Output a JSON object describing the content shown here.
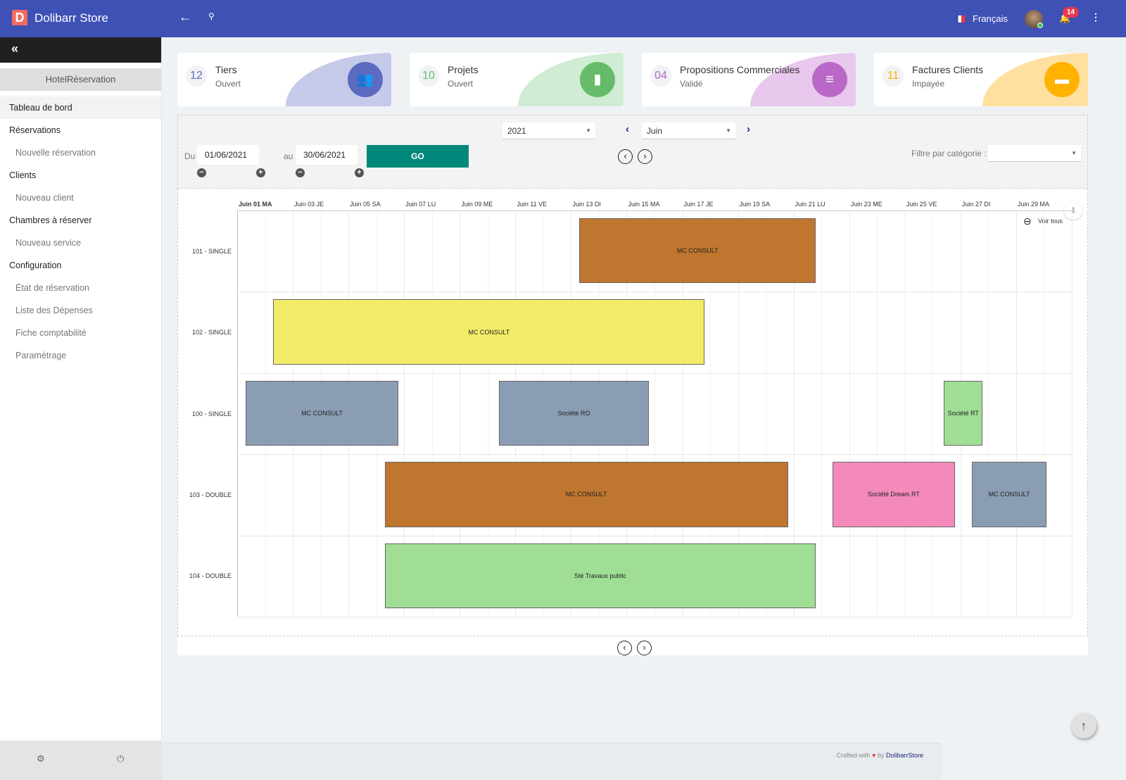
{
  "header": {
    "brand": "Dolibarr Store",
    "logo_letter": "D",
    "language": "Français",
    "notifications": "14"
  },
  "sidebar": {
    "collapse_icon": "«",
    "module": "HotelRéservation",
    "items": [
      {
        "label": "Tableau de bord",
        "type": "main",
        "active": true
      },
      {
        "label": "Réservations",
        "type": "main"
      },
      {
        "label": "Nouvelle réservation",
        "type": "sub"
      },
      {
        "label": "Clients",
        "type": "main"
      },
      {
        "label": "Nouveau client",
        "type": "sub"
      },
      {
        "label": "Chambres à réserver",
        "type": "main"
      },
      {
        "label": "Nouveau service",
        "type": "sub"
      },
      {
        "label": "Configuration",
        "type": "main"
      },
      {
        "label": "État de réservation",
        "type": "sub"
      },
      {
        "label": "Liste des Dépenses",
        "type": "sub"
      },
      {
        "label": "Fiche comptabilité",
        "type": "sub"
      },
      {
        "label": "Paramétrage",
        "type": "sub"
      }
    ]
  },
  "cards": [
    {
      "num": "12",
      "title": "Tiers",
      "status": "Ouvert",
      "color": "#5c6bc0",
      "light": "#c5cae9",
      "icon": "users-icon"
    },
    {
      "num": "10",
      "title": "Projets",
      "status": "Ouvert",
      "color": "#66bb6a",
      "light": "#d0ecd2",
      "icon": "file-icon"
    },
    {
      "num": "04",
      "title": "Propositions Commerciales",
      "status": "Validé",
      "color": "#ba68c8",
      "light": "#e8c8ec",
      "icon": "document-icon"
    },
    {
      "num": "11",
      "title": "Factures Clients",
      "status": "Impayée",
      "color": "#ffb300",
      "light": "#ffe0a0",
      "icon": "folder-icon"
    }
  ],
  "filters": {
    "year": "2021",
    "month": "Juin",
    "du_label": "Du",
    "du_value": "01/06/2021",
    "au_label": "au",
    "au_value": "30/06/2021",
    "go": "GO",
    "category_label": "Filtre par catégorie :",
    "category_value": ""
  },
  "chart_data": {
    "type": "gantt",
    "x_unit": "day of June 2021",
    "xlim": [
      1,
      31
    ],
    "ticks": [
      "Juin 01 MA",
      "Juin 03 JE",
      "Juin 05 SA",
      "Juin 07 LU",
      "Juin 09 ME",
      "Juin 11 VE",
      "Juin 13 DI",
      "Juin 15 MA",
      "Juin 17 JE",
      "Juin 19 SA",
      "Juin 21 LU",
      "Juin 23 ME",
      "Juin 25 VE",
      "Juin 27 DI",
      "Juin 29 MA"
    ],
    "rows": [
      "101 - SINGLE",
      "102 - SINGLE",
      "100 - SINGLE",
      "103 - DOUBLE",
      "104 - DOUBLE"
    ],
    "bars": [
      {
        "row": 0,
        "label": "MC CONSULT",
        "start": 13.3,
        "end": 21.8,
        "color": "#bf762e"
      },
      {
        "row": 1,
        "label": "MC CONSULT",
        "start": 2.3,
        "end": 17.8,
        "color": "#f3ec68"
      },
      {
        "row": 2,
        "label": "MC CONSULT",
        "start": 1.3,
        "end": 6.8,
        "color": "#8a9db3"
      },
      {
        "row": 2,
        "label": "Société RO",
        "start": 10.4,
        "end": 15.8,
        "color": "#8a9db3"
      },
      {
        "row": 2,
        "label": "Société RT",
        "start": 26.4,
        "end": 27.8,
        "color": "#a0de96"
      },
      {
        "row": 3,
        "label": "MC CONSULT",
        "start": 6.3,
        "end": 20.8,
        "color": "#bf762e"
      },
      {
        "row": 3,
        "label": "Société Dream RT",
        "start": 22.4,
        "end": 26.8,
        "color": "#f48abb"
      },
      {
        "row": 3,
        "label": "MC CONSULT",
        "start": 27.4,
        "end": 30.1,
        "color": "#8a9db3"
      },
      {
        "row": 4,
        "label": "Sté Travaux public",
        "start": 6.3,
        "end": 21.8,
        "color": "#a0de96"
      }
    ],
    "zoom_label": "Voir tous"
  },
  "footer": {
    "text": "Crafted with",
    "by": "by",
    "author": "DolibarrStore"
  }
}
